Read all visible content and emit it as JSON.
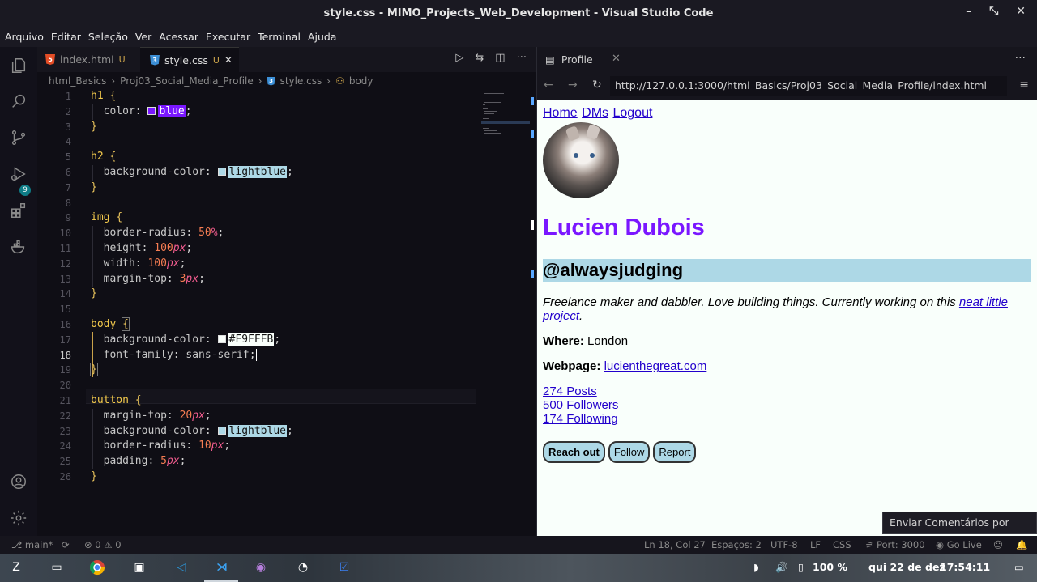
{
  "window": {
    "title": "style.css - MIMO_Projects_Web_Development - Visual Studio Code",
    "controls": [
      "–",
      "⤡",
      "✕"
    ]
  },
  "menu": [
    "Arquivo",
    "Editar",
    "Seleção",
    "Ver",
    "Acessar",
    "Executar",
    "Terminal",
    "Ajuda"
  ],
  "activity": {
    "source_control_badge": "9"
  },
  "tabs": [
    {
      "label": "index.html",
      "modified": "U"
    },
    {
      "label": "style.css",
      "modified": "U",
      "close": "✕"
    }
  ],
  "breadcrumb": [
    "html_Basics",
    "Proj03_Social_Media_Profile",
    "style.css",
    "body"
  ],
  "editor": {
    "line_numbers": [
      "1",
      "2",
      "3",
      "4",
      "5",
      "6",
      "7",
      "8",
      "9",
      "10",
      "11",
      "12",
      "13",
      "14",
      "15",
      "16",
      "17",
      "18",
      "19",
      "20",
      "21",
      "22",
      "23",
      "24",
      "25",
      "26"
    ],
    "lines": {
      "l1": "h1",
      "l2p": "color: ",
      "l2v": "blue",
      "l5": "h2",
      "l6p": "background-color: ",
      "l6v": "lightblue",
      "l9": "img",
      "l10p": "border-radius: ",
      "l10n": "50",
      "l10u": "%",
      "l11p": "height: ",
      "l11n": "100",
      "l11u": "px",
      "l12p": "width: ",
      "l12n": "100",
      "l12u": "px",
      "l13p": "margin-top: ",
      "l13n": "3",
      "l13u": "px",
      "l16": "body",
      "l17p": "background-color: ",
      "l17v": "#F9FFFB",
      "l18p": "font-family: ",
      "l18v": "sans-serif",
      "l21": "button",
      "l22p": "margin-top: ",
      "l22n": "20",
      "l22u": "px",
      "l23p": "background-color: ",
      "l23v": "lightblue",
      "l24p": "border-radius: ",
      "l24n": "10",
      "l24u": "px",
      "l25p": "padding: ",
      "l25n": "5",
      "l25u": "px"
    },
    "swatches": {
      "blue": "#7a17ff",
      "lightblue": "#add8e6",
      "hex": "#F9FFFB"
    }
  },
  "browser": {
    "tab": "Profile",
    "url": "http://127.0.0.1:3000/html_Basics/Proj03_Social_Media_Profile/index.html",
    "page": {
      "nav": [
        "Home",
        "DMs",
        "Logout"
      ],
      "name": "Lucien Dubois",
      "handle": "@alwaysjudging",
      "bio_text": "Freelance maker and dabbler. Love building things. Currently working on this ",
      "bio_link": "neat little project",
      "bio_end": ".",
      "where_label": "Where:",
      "where_value": " London",
      "webpage_label": "Webpage:",
      "webpage_value": "lucienthegreat.com",
      "stats": [
        "274 Posts",
        "500 Followers",
        "174 Following"
      ],
      "buttons": [
        "Reach out",
        "Follow",
        "Report"
      ]
    }
  },
  "tooltip": "Enviar Comentários por Tweet",
  "status": {
    "branch": "main*",
    "problems": "⊗ 0 ⚠ 0",
    "position": "Ln 18, Col 27",
    "spaces": "Espaços: 2",
    "encoding": "UTF-8",
    "eol": "LF",
    "language": "CSS",
    "port": "Port: 3000",
    "golive": "Go Live"
  },
  "taskbar": {
    "battery": "100 %",
    "date": "qui 22 de dez",
    "time": "17:54:11"
  }
}
